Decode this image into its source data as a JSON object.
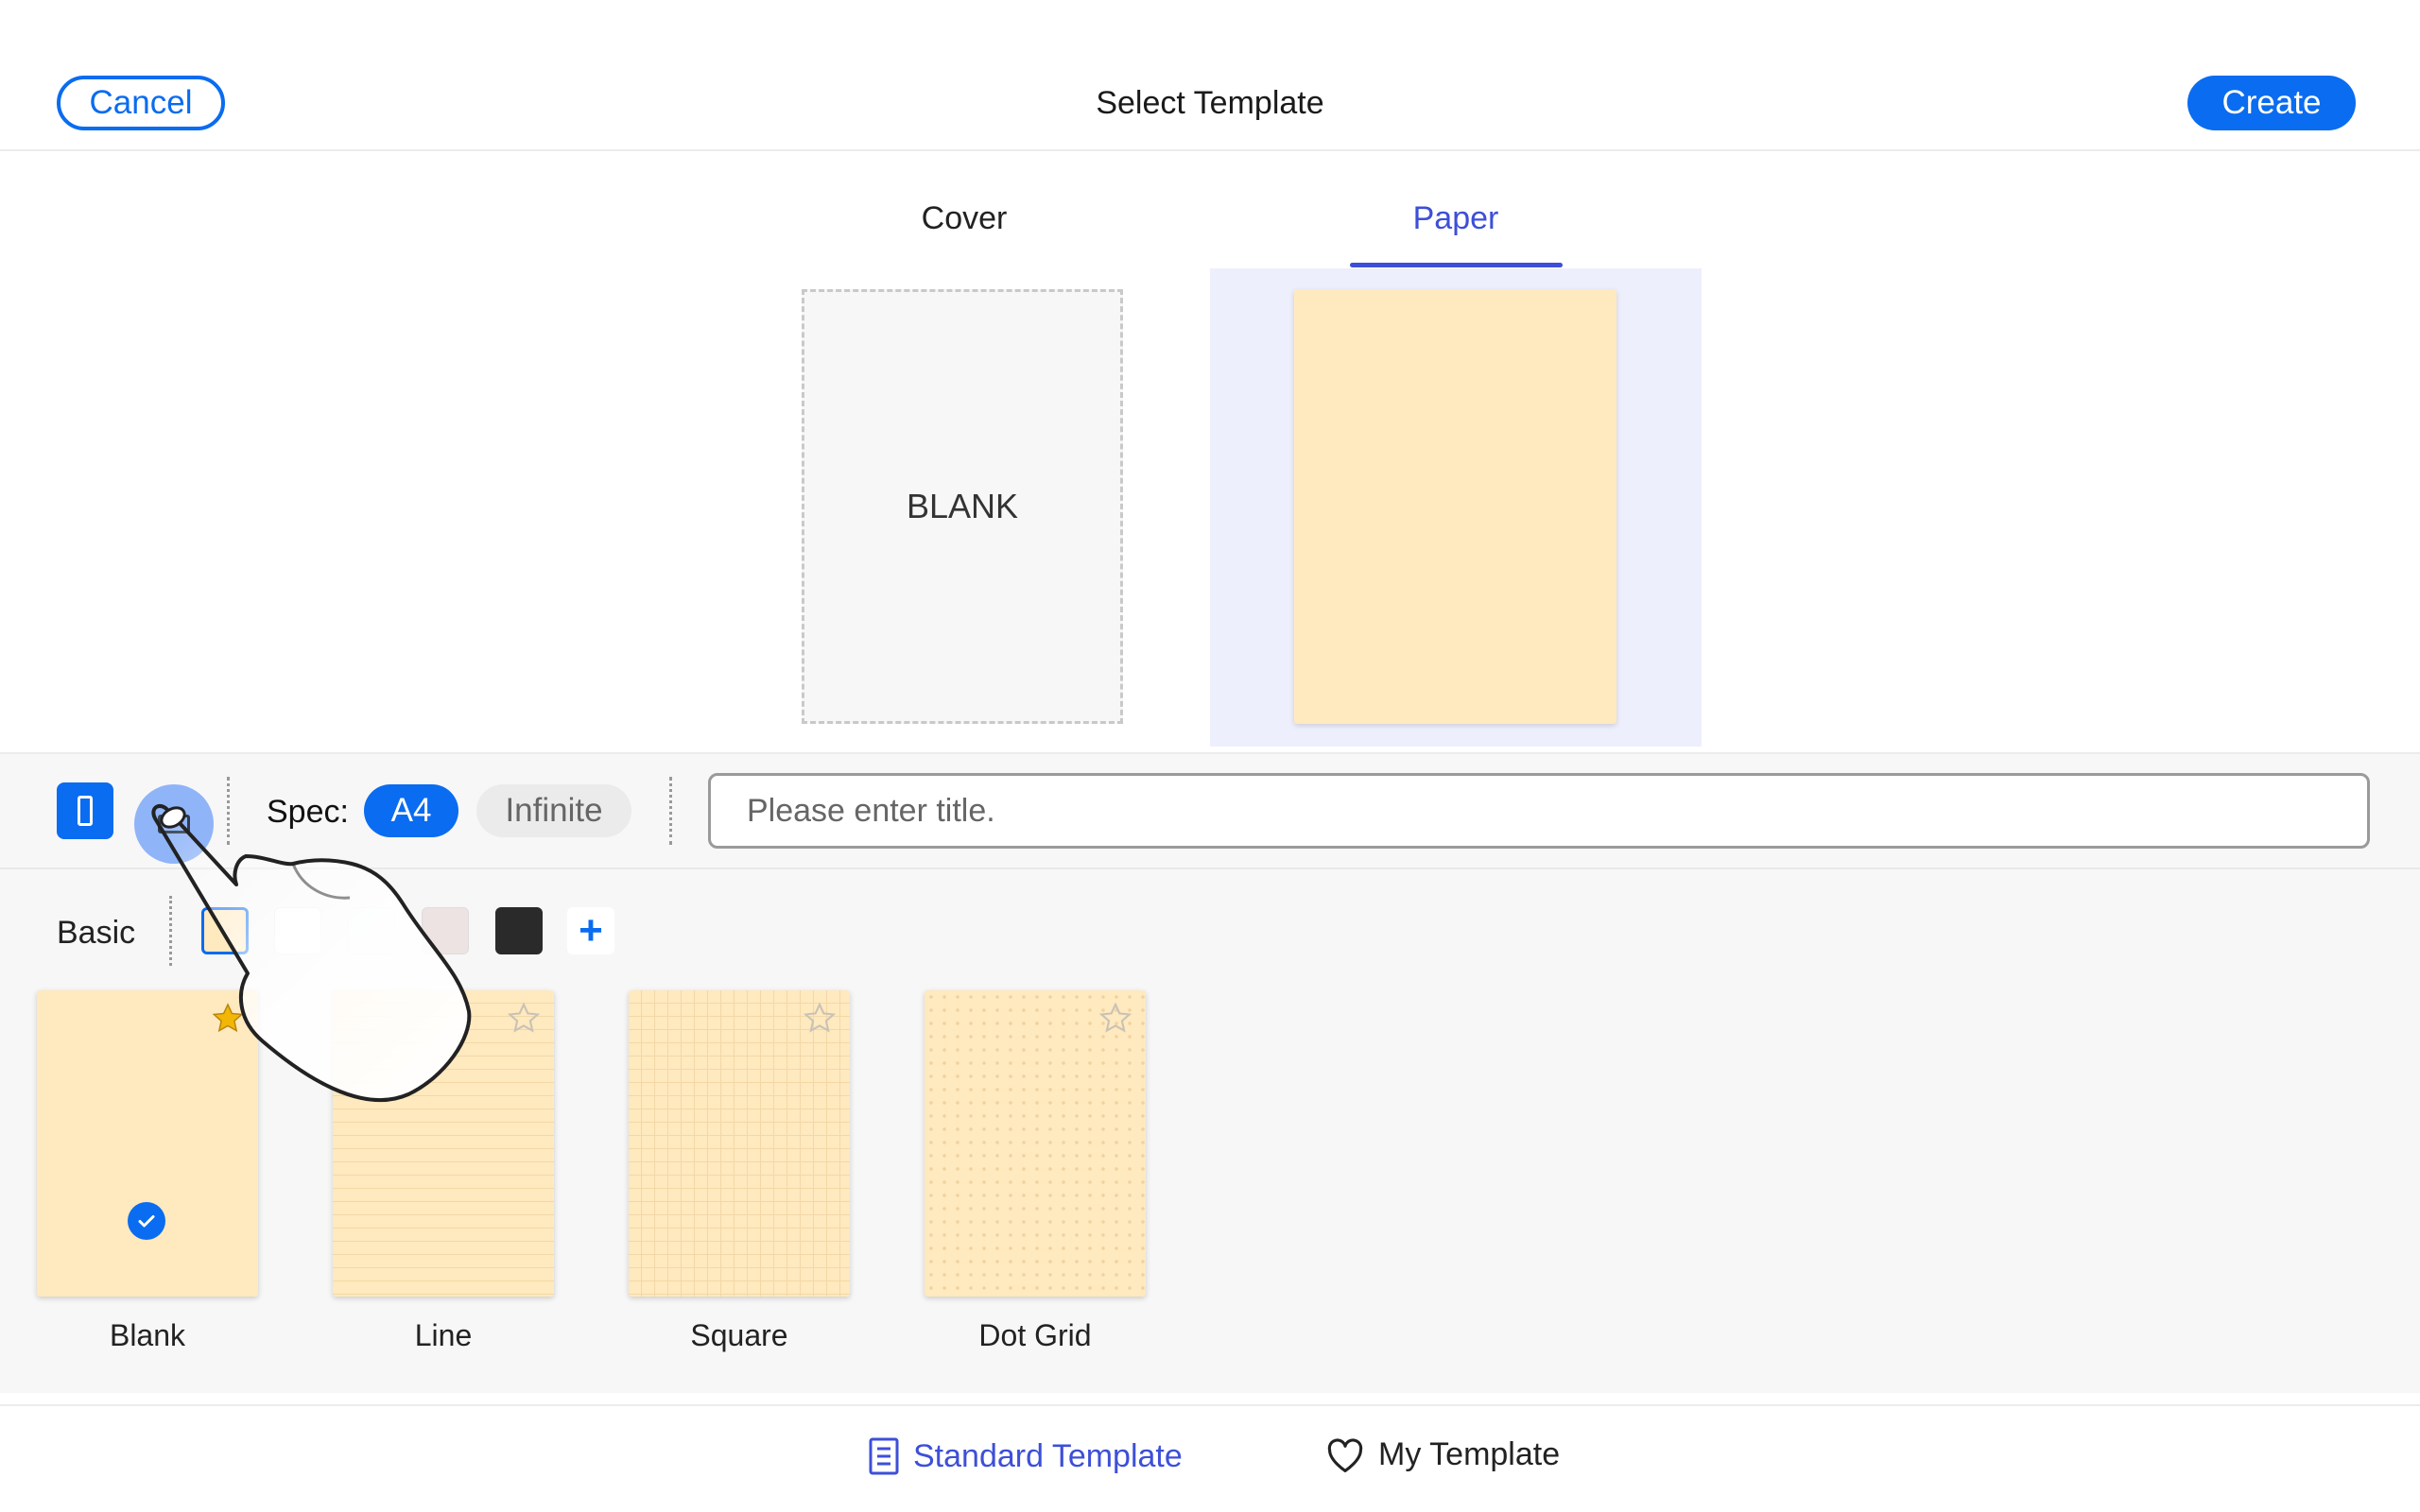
{
  "header": {
    "cancel_label": "Cancel",
    "title": "Select Template",
    "create_label": "Create"
  },
  "tabs": [
    {
      "label": "Cover",
      "active": false
    },
    {
      "label": "Paper",
      "active": true
    }
  ],
  "preview": {
    "cover_text": "BLANK"
  },
  "toolbar": {
    "orientation_selected": "portrait",
    "spec_label": "Spec:",
    "spec_options": [
      {
        "label": "A4",
        "selected": true
      },
      {
        "label": "Infinite",
        "selected": false
      }
    ],
    "title_placeholder": "Please enter title."
  },
  "colors": {
    "category_label": "Basic",
    "swatches": [
      "#ffe9bf",
      "#fefefe",
      "#f6f8f8",
      "#ede3e3",
      "#2a2a2a"
    ],
    "selected_index": 0,
    "add_label": "+"
  },
  "templates": [
    {
      "label": "Blank",
      "favorite": true,
      "selected": true
    },
    {
      "label": "Line",
      "favorite": false,
      "selected": false
    },
    {
      "label": "Square",
      "favorite": false,
      "selected": false
    },
    {
      "label": "Dot Grid",
      "favorite": false,
      "selected": false
    }
  ],
  "bottom_nav": {
    "standard_label": "Standard Template",
    "my_label": "My Template",
    "active": "standard"
  },
  "accent_color": "#0a6cf0",
  "tab_accent_color": "#3d4fd8"
}
